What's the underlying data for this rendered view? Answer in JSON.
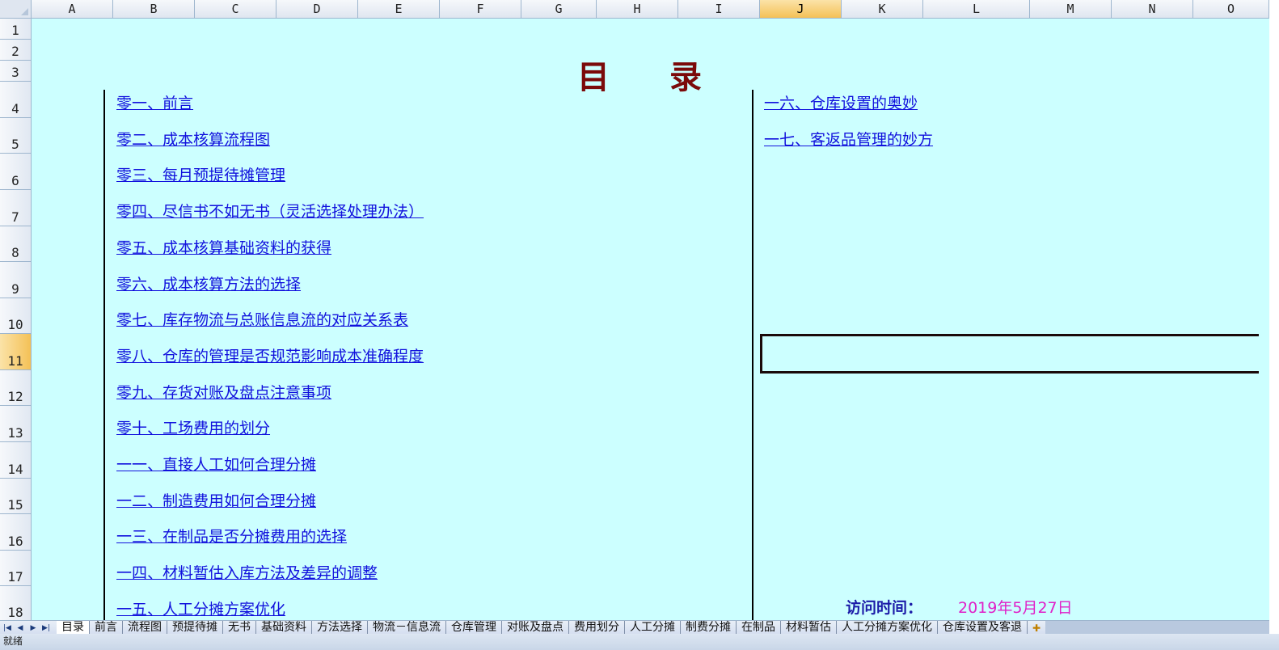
{
  "columns": [
    "A",
    "B",
    "C",
    "D",
    "E",
    "F",
    "G",
    "H",
    "I",
    "J",
    "K",
    "L",
    "M",
    "N",
    "O"
  ],
  "rows": [
    "1",
    "2",
    "3",
    "4",
    "5",
    "6",
    "7",
    "8",
    "9",
    "10",
    "11",
    "12",
    "13",
    "14",
    "15",
    "16",
    "17",
    "18"
  ],
  "title": {
    "char1": "目",
    "char2": "录"
  },
  "toc_left": [
    "零一、前言",
    "零二、成本核算流程图",
    "零三、每月预提待摊管理",
    "零四、尽信书不如无书（灵活选择处理办法）",
    "零五、成本核算基础资料的获得",
    "零六、成本核算方法的选择",
    "零七、库存物流与总账信息流的对应关系表",
    "零八、仓库的管理是否规范影响成本准确程度",
    "零九、存货对账及盘点注意事项",
    "零十、工场费用的划分",
    "一一、直接人工如何合理分摊",
    "一二、制造费用如何合理分摊",
    "一三、在制品是否分摊费用的选择",
    "一四、材料暂估入库方法及差异的调整",
    "一五、人工分摊方案优化"
  ],
  "toc_right": [
    "一六、仓库设置的奥妙",
    "一七、客返品管理的妙方"
  ],
  "visit": {
    "label": "访问时间：",
    "date": "2019年5月27日"
  },
  "sheet_tabs": [
    "目录",
    "前言",
    "流程图",
    "预提待摊",
    "无书",
    "基础资料",
    "方法选择",
    "物流－信息流",
    "仓库管理",
    "对账及盘点",
    "费用划分",
    "人工分摊",
    "制费分摊",
    "在制品",
    "材料暂估",
    "人工分摊方案优化",
    "仓库设置及客退"
  ],
  "active_tab": "目录",
  "nav_icons": [
    "first-sheet-icon",
    "prev-sheet-icon",
    "next-sheet-icon",
    "last-sheet-icon"
  ],
  "status_text": "就绪",
  "colors": {
    "sheet_bg": "#ccffff",
    "link": "#1111dd",
    "title": "#7b0a0a",
    "date": "#e020c8"
  },
  "selected_cell": "J11"
}
